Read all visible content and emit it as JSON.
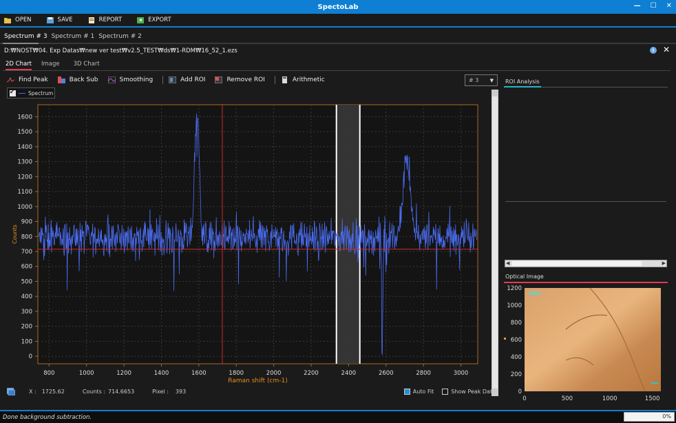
{
  "app": {
    "title": "SpectoLab"
  },
  "toolbar": {
    "open": "OPEN",
    "save": "SAVE",
    "report": "REPORT",
    "export": "EXPORT"
  },
  "spectrum_tabs": [
    "Spectrum # 3",
    "Spectrum # 1",
    "Spectrum # 2"
  ],
  "file_path": "D:₩NOST₩04. Exp Datas₩new ver test₩v2.5_TEST₩ds₩1-RDM₩16_52_1.ezs",
  "view_tabs": [
    "2D Chart",
    "Image",
    "3D Chart"
  ],
  "chart_tools": {
    "find_peak": "Find Peak",
    "back_sub": "Back Sub",
    "smoothing": "Smoothing",
    "add_roi": "Add ROI",
    "remove_roi": "Remove ROI",
    "arithmetic": "Arithmetic"
  },
  "spectrum_select": "# 3",
  "legend": {
    "label": "Spectrum"
  },
  "status": {
    "x_label": "X :",
    "x_value": "1725.62",
    "counts_label": "Counts :",
    "counts_value": "714.6653",
    "pixel_label": "Pixel :",
    "pixel_value": "393",
    "auto_fit": "Auto Fit",
    "show_peak_data": "Show Peak Data"
  },
  "right_panel": {
    "roi_tab": "ROI Analysis",
    "optical_tab": "Optical Image",
    "magnification": "100x"
  },
  "footer": {
    "message": "Done background subtraction.",
    "progress": "0%"
  },
  "colors": {
    "accent": "#0e7fd3",
    "spectrum": "#4a6cf0",
    "cursor": "#d42a2a",
    "axis_label": "#e8901e"
  },
  "chart_data": [
    {
      "type": "line",
      "xlabel": "Raman shift (cm-1)",
      "ylabel": "Counts",
      "xlim": [
        740,
        3090
      ],
      "ylim": [
        -50,
        1680
      ],
      "x_ticks": [
        800,
        1000,
        1200,
        1400,
        1600,
        1800,
        2000,
        2200,
        2400,
        2600,
        2800,
        3000
      ],
      "y_ticks": [
        0,
        100,
        200,
        300,
        400,
        500,
        600,
        700,
        800,
        900,
        1000,
        1100,
        1200,
        1300,
        1400,
        1500,
        1600
      ],
      "series": [
        {
          "name": "Spectrum",
          "baseline": 790,
          "noise": 90,
          "peaks": [
            {
              "x": 1590,
              "height": 800,
              "width": 18
            },
            {
              "x": 2710,
              "height": 500,
              "width": 28
            },
            {
              "x": 2580,
              "height": -780,
              "width": 4
            }
          ]
        }
      ],
      "cursor": {
        "x": 1725.62,
        "y": 714.6653
      },
      "roi": {
        "x_start": 2335,
        "x_end": 2460
      },
      "grid": true
    },
    {
      "type": "heatmap",
      "xlim": [
        0,
        1600
      ],
      "ylim": [
        0,
        1200
      ],
      "x_ticks": [
        0,
        500,
        1000,
        1500
      ],
      "y_ticks": [
        0,
        200,
        400,
        600,
        800,
        1000,
        1200
      ]
    }
  ]
}
